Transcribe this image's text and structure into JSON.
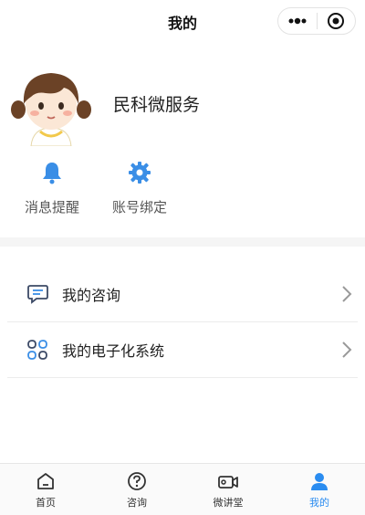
{
  "nav": {
    "title": "我的"
  },
  "profile": {
    "name": "民科微服务"
  },
  "shortcuts": [
    {
      "label": "消息提醒",
      "icon": "bell-icon"
    },
    {
      "label": "账号绑定",
      "icon": "gear-icon"
    }
  ],
  "menu": [
    {
      "label": "我的咨询",
      "icon": "chat-icon"
    },
    {
      "label": "我的电子化系统",
      "icon": "apps-icon"
    }
  ],
  "tabs": [
    {
      "label": "首页",
      "icon": "home-icon",
      "active": false
    },
    {
      "label": "咨询",
      "icon": "question-icon",
      "active": false
    },
    {
      "label": "微讲堂",
      "icon": "video-icon",
      "active": false
    },
    {
      "label": "我的",
      "icon": "user-icon",
      "active": true
    }
  ],
  "colors": {
    "accent": "#2a8cf0",
    "icon_blue": "#3a8ee6"
  }
}
